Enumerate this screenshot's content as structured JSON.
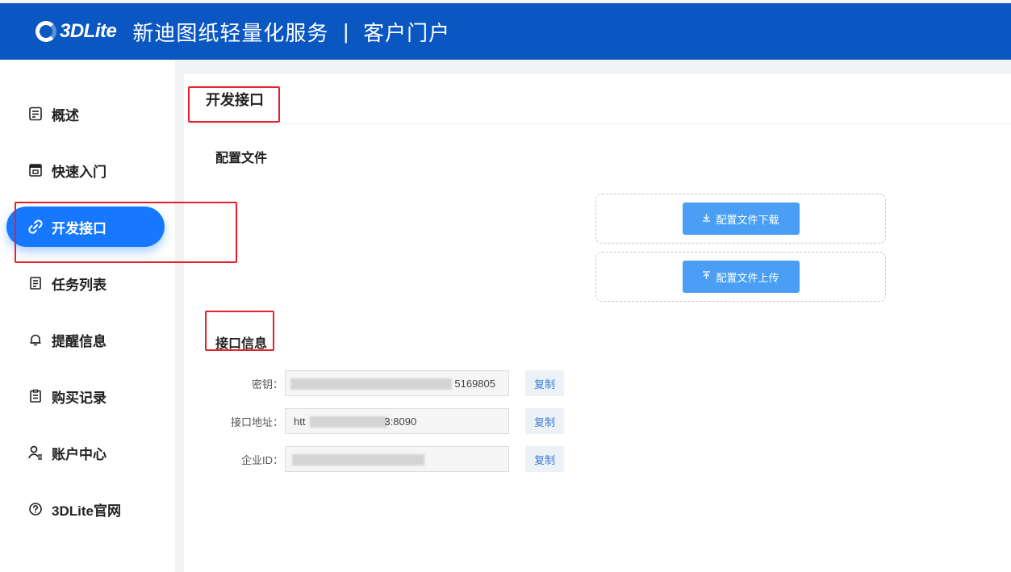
{
  "header": {
    "logo_text": "3DLite",
    "title": "新迪图纸轻量化服务",
    "separator": "|",
    "subtitle": "客户门户"
  },
  "sidebar": {
    "items": [
      {
        "label": "概述",
        "icon": "document-list-icon"
      },
      {
        "label": "快速入门",
        "icon": "calendar-icon"
      },
      {
        "label": "开发接口",
        "icon": "link-icon",
        "active": true
      },
      {
        "label": "任务列表",
        "icon": "clipboard-icon"
      },
      {
        "label": "提醒信息",
        "icon": "bell-icon"
      },
      {
        "label": "购买记录",
        "icon": "receipt-icon"
      },
      {
        "label": "账户中心",
        "icon": "user-icon"
      },
      {
        "label": "3DLite官网",
        "icon": "question-circle-icon"
      }
    ]
  },
  "main": {
    "page_title": "开发接口",
    "config_section": {
      "title": "配置文件",
      "download_label": "配置文件下载",
      "upload_label": "配置文件上传"
    },
    "api_section": {
      "title": "接口信息",
      "fields": [
        {
          "label": "密钥：",
          "value": "5169805",
          "copy_label": "复制"
        },
        {
          "label": "接口地址：",
          "value_prefix": "htt",
          "value": "3:8090",
          "copy_label": "复制"
        },
        {
          "label": "企业ID：",
          "value": "",
          "copy_label": "复制"
        }
      ]
    }
  },
  "colors": {
    "header_bg": "#0a57c2",
    "active_nav": "#1677ff",
    "primary_button": "#4a9ff5",
    "annotation": "#e8202a"
  }
}
